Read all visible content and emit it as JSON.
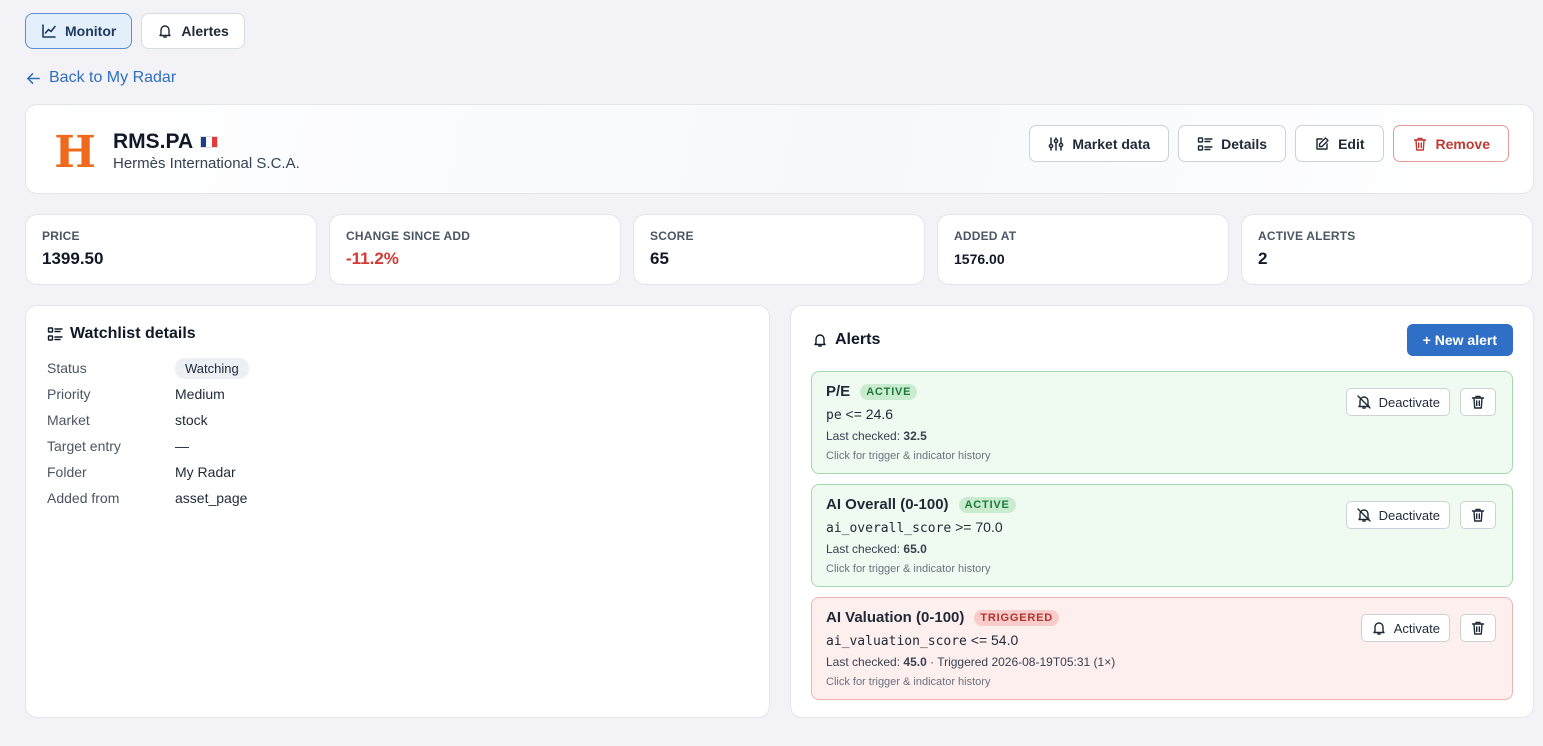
{
  "tabs": [
    {
      "label": "Monitor",
      "icon": "line-chart-icon",
      "active": true
    },
    {
      "label": "Alertes",
      "icon": "bell-icon",
      "active": false
    }
  ],
  "back_link": "Back to My Radar",
  "asset": {
    "ticker": "RMS.PA",
    "company": "Hermès International S.C.A.",
    "logo_letter": "H",
    "flag": "france-flag-icon"
  },
  "header_actions": {
    "market_data": "Market data",
    "details": "Details",
    "edit": "Edit",
    "remove": "Remove"
  },
  "stats": [
    {
      "label": "PRICE",
      "value": "1399.50"
    },
    {
      "label": "CHANGE SINCE ADD",
      "value": "-11.2%"
    },
    {
      "label": "SCORE",
      "value": "65"
    },
    {
      "label": "ADDED AT",
      "value": "1576.00"
    },
    {
      "label": "ACTIVE ALERTS",
      "value": "2"
    }
  ],
  "watchlist": {
    "title": "Watchlist details",
    "rows": [
      {
        "key": "Status",
        "value": "Watching"
      },
      {
        "key": "Priority",
        "value": "Medium"
      },
      {
        "key": "Market",
        "value": "stock"
      },
      {
        "key": "Target entry",
        "value": "—"
      },
      {
        "key": "Folder",
        "value": "My Radar"
      },
      {
        "key": "Added from",
        "value": "asset_page"
      }
    ]
  },
  "alerts": {
    "title": "Alerts",
    "new_alert": "+ New alert",
    "items": [
      {
        "name": "P/E",
        "status": "ACTIVE",
        "metric": "pe",
        "condition": " <= 24.6",
        "checked_label": "Last checked: ",
        "checked_value": "32.5",
        "triggered_text": "",
        "hint": "Click for trigger & indicator history",
        "action": "Deactivate"
      },
      {
        "name": "AI Overall (0-100)",
        "status": "ACTIVE",
        "metric": "ai_overall_score",
        "condition": " >= 70.0",
        "checked_label": "Last checked: ",
        "checked_value": "65.0",
        "triggered_text": "",
        "hint": "Click for trigger & indicator history",
        "action": "Deactivate"
      },
      {
        "name": "AI Valuation (0-100)",
        "status": "TRIGGERED",
        "metric": "ai_valuation_score",
        "condition": " <= 54.0",
        "checked_label": "Last checked: ",
        "checked_value": "45.0",
        "triggered_text": " · Triggered 2026-08-19T05:31 (1×)",
        "hint": "Click for trigger & indicator history",
        "action": "Activate"
      }
    ]
  }
}
